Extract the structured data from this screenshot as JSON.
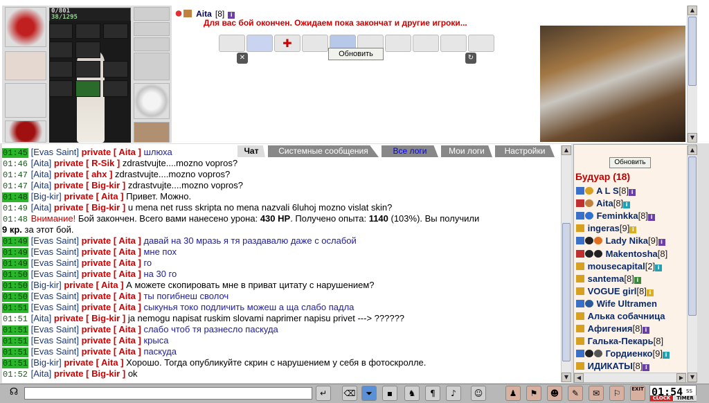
{
  "character": {
    "hp": "0/801",
    "mp": "38/1295"
  },
  "battle": {
    "player_name": "Aita",
    "player_level": "[8]",
    "status_message": "Для вас бой окончен. Ожидаем пока закончат и другие игроки...",
    "refresh_label": "Обновить"
  },
  "tabs": [
    {
      "label": "Чат"
    },
    {
      "label": "Системные сообщения"
    },
    {
      "label": "Все логи"
    },
    {
      "label": "Мои логи"
    },
    {
      "label": "Настройки"
    }
  ],
  "chat": [
    {
      "time": "01:45",
      "hl": true,
      "from": "[Evas Saint]",
      "to": "private [ Aita ]",
      "text": "шлюха",
      "blue": true
    },
    {
      "time": "01:46",
      "hl": false,
      "from": "[Aita]",
      "to": "private [ R-Sik ]",
      "text": "zdrastvujte....mozno vopros?",
      "blue": false
    },
    {
      "time": "01:47",
      "hl": false,
      "from": "[Aita]",
      "to": "private [ ahx ]",
      "text": "zdrastvujte....mozno vopros?",
      "blue": false
    },
    {
      "time": "01:47",
      "hl": false,
      "from": "[Aita]",
      "to": "private [ Big-kir ]",
      "text": "zdrastvujte....mozno vopros?",
      "blue": false
    },
    {
      "time": "01:48",
      "hl": true,
      "from": "[Big-kir]",
      "to": "private [ Aita ]",
      "text": "Привет. Можно.",
      "blue": false
    },
    {
      "time": "01:49",
      "hl": false,
      "from": "[Aita]",
      "to": "private [ Big-kir ]",
      "text": "u mena net russ skripta no mena nazvali 6luhoj mozno vislat skin?",
      "blue": false
    },
    {
      "time": "01:49",
      "hl": true,
      "from": "[Evas Saint]",
      "to": "private [ Aita ]",
      "text": "давай на 30 мразь я тя раздавалю даже с ослабой",
      "blue": true
    },
    {
      "time": "01:49",
      "hl": true,
      "from": "[Evas Saint]",
      "to": "private [ Aita ]",
      "text": "мне пох",
      "blue": true
    },
    {
      "time": "01:49",
      "hl": true,
      "from": "[Evas Saint]",
      "to": "private [ Aita ]",
      "text": "го",
      "blue": true
    },
    {
      "time": "01:50",
      "hl": true,
      "from": "[Evas Saint]",
      "to": "private [ Aita ]",
      "text": "на 30 го",
      "blue": true
    },
    {
      "time": "01:50",
      "hl": true,
      "from": "[Big-kir]",
      "to": "private [ Aita ]",
      "text": "А можете скопировать мне в приват цитату с нарушением?",
      "blue": false
    },
    {
      "time": "01:50",
      "hl": true,
      "from": "[Evas Saint]",
      "to": "private [ Aita ]",
      "text": "ты погибнеш сволоч",
      "blue": true
    },
    {
      "time": "01:51",
      "hl": true,
      "from": "[Evas Saint]",
      "to": "private [ Aita ]",
      "text": "сыкунья токо подличить можеш а ща слабо падла",
      "blue": true
    },
    {
      "time": "01:51",
      "hl": false,
      "from": "[Aita]",
      "to": "private [ Big-kir ]",
      "text": "ja nemogu napisat ruskim slovami naprimer napisu privet ---> ??????",
      "blue": false
    },
    {
      "time": "01:51",
      "hl": true,
      "from": "[Evas Saint]",
      "to": "private [ Aita ]",
      "text": "слабо чтоб тя разнесло паскуда",
      "blue": true
    },
    {
      "time": "01:51",
      "hl": true,
      "from": "[Evas Saint]",
      "to": "private [ Aita ]",
      "text": "крыса",
      "blue": true
    },
    {
      "time": "01:51",
      "hl": true,
      "from": "[Evas Saint]",
      "to": "private [ Aita ]",
      "text": "паскуда",
      "blue": true
    },
    {
      "time": "01:51",
      "hl": true,
      "from": "[Big-kir]",
      "to": "private [ Aita ]",
      "text": "Хорошо. Тогда опубликуйте скрин с нарушением у себя в фотоскролле.",
      "blue": false
    },
    {
      "time": "01:52",
      "hl": false,
      "from": "[Aita]",
      "to": "private [ Big-kir ]",
      "text": "ok",
      "blue": false
    }
  ],
  "system_line": {
    "time": "01:48",
    "warn": "Внимание!",
    "p1": " Бой закончен. Всего вами нанесено урона: ",
    "dmg": "430 HP",
    "p2": ". Получено опыта: ",
    "exp": "1140",
    "p3": " (103%). Вы получили",
    "money": "9 кр.",
    "p4": " за этот бой."
  },
  "userlist": {
    "refresh_label": "Обновить",
    "room": "Будуар (18)",
    "users": [
      {
        "name": "A L S",
        "level": "[8]",
        "badge": "p"
      },
      {
        "name": "Aita",
        "level": "[8]",
        "badge": "c"
      },
      {
        "name": "Feminkka",
        "level": "[8]",
        "badge": "p"
      },
      {
        "name": "ingeras",
        "level": "[9]",
        "badge": "y"
      },
      {
        "name": "Lady Nika",
        "level": "[9]",
        "badge": "p"
      },
      {
        "name": "Makentosha",
        "level": "[8]",
        "badge": ""
      },
      {
        "name": "mousecapital",
        "level": "[2]",
        "badge": "c"
      },
      {
        "name": "santema",
        "level": "[8]",
        "badge": "g"
      },
      {
        "name": "VOGUE girl",
        "level": "[8]",
        "badge": "y"
      },
      {
        "name": "Wife Ultramen",
        "level": "",
        "badge": ""
      },
      {
        "name": "Алька собачница",
        "level": "",
        "badge": ""
      },
      {
        "name": "Афигения",
        "level": "[8]",
        "badge": "p"
      },
      {
        "name": "Галька-Пекарь",
        "level": "[8]",
        "badge": ""
      },
      {
        "name": "Гордиенко",
        "level": "[9]",
        "badge": "c"
      },
      {
        "name": "ИДИКАТЫ",
        "level": "[8]",
        "badge": "p"
      }
    ]
  },
  "clock": {
    "time": "01:54",
    "suffix": "SS",
    "exit": "EXIT",
    "clock_label": "CLOCK",
    "timer_label": "TIMER"
  }
}
